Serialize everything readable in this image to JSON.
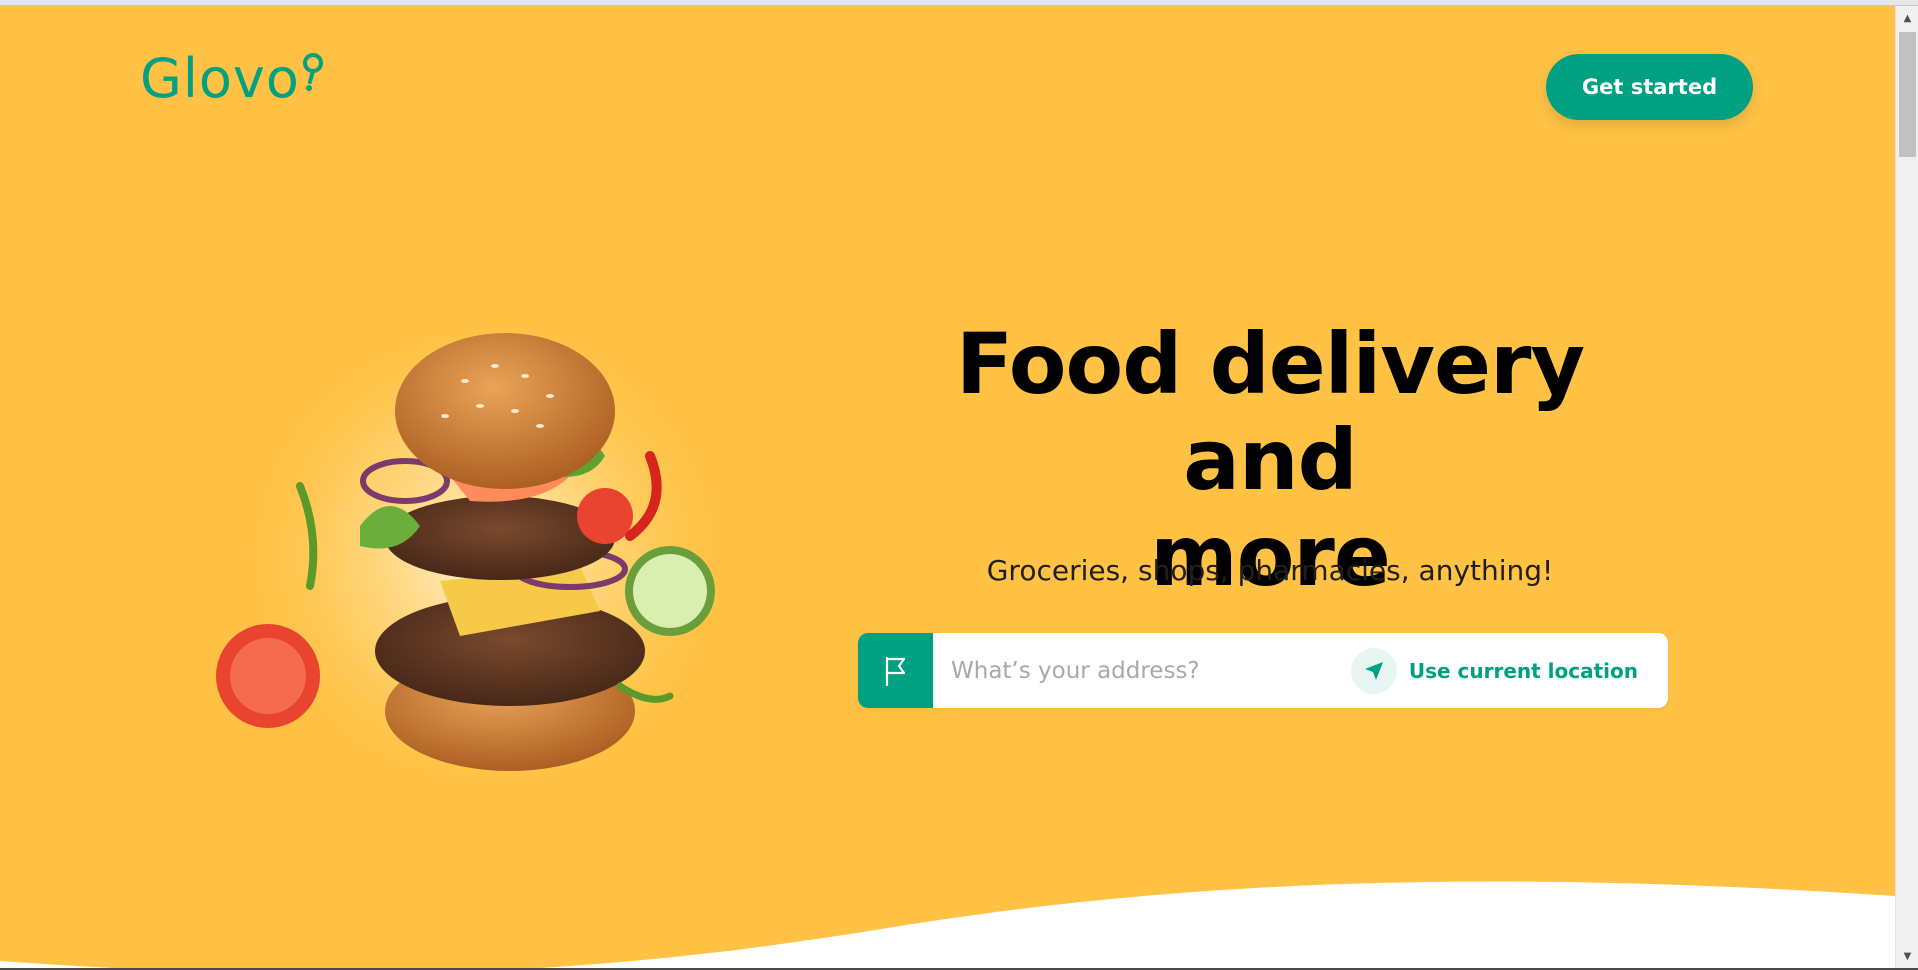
{
  "header": {
    "logo_text": "Glovo",
    "get_started_label": "Get started"
  },
  "hero": {
    "title_line1": "Food delivery and",
    "title_line2": "more",
    "subtitle": "Groceries, shops, pharmacies, anything!",
    "image_icon": "burger-illustration"
  },
  "address": {
    "placeholder": "What’s your address?",
    "value": "",
    "flag_icon": "flag-icon",
    "location_icon": "navigation-arrow-icon",
    "use_location_label": "Use current location"
  },
  "colors": {
    "background": "#FFC244",
    "brand_green": "#00A082",
    "text": "#000000"
  }
}
